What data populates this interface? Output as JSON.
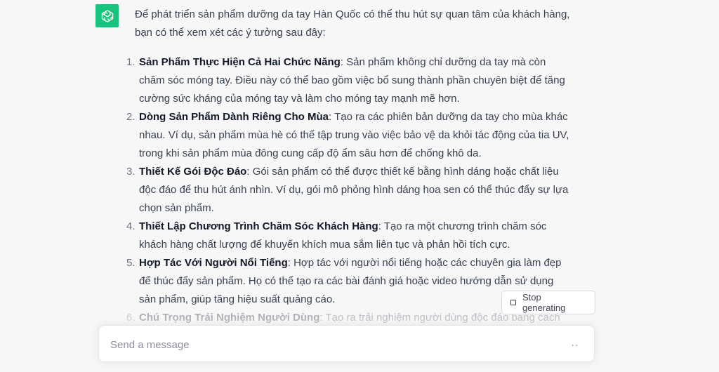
{
  "assistant_message": {
    "intro": "Để phát triển sản phẩm dưỡng da tay Hàn Quốc có thể thu hút sự quan tâm của khách hàng, bạn có thể xem xét các ý tưởng sau đây:",
    "items": [
      {
        "number": "1.",
        "title": "Sản Phẩm Thực Hiện Cả Hai Chức Năng",
        "text": ": Sản phẩm không chỉ dưỡng da tay mà còn chăm sóc móng tay. Điều này có thể bao gồm việc bổ sung thành phần chuyên biệt để tăng cường sức kháng của móng tay và làm cho móng tay mạnh mẽ hơn."
      },
      {
        "number": "2.",
        "title": "Dòng Sản Phẩm Dành Riêng Cho Mùa",
        "text": ": Tạo ra các phiên bản dưỡng da tay cho mùa khác nhau. Ví dụ, sản phẩm mùa hè có thể tập trung vào việc bảo vệ da khỏi tác động của tia UV, trong khi sản phẩm mùa đông cung cấp độ ẩm sâu hơn để chống khô da."
      },
      {
        "number": "3.",
        "title": "Thiết Kế Gói Độc Đáo",
        "text": ": Gói sản phẩm có thể được thiết kế bằng hình dáng hoặc chất liệu độc đáo để thu hút ánh nhìn. Ví dụ, gói mô phỏng hình dáng hoa sen có thể thúc đẩy sự lựa chọn sản phẩm."
      },
      {
        "number": "4.",
        "title": "Thiết Lập Chương Trình Chăm Sóc Khách Hàng",
        "text": ": Tạo ra một chương trình chăm sóc khách hàng chất lượng để khuyến khích mua sắm liên tục và phản hồi tích cực."
      },
      {
        "number": "5.",
        "title": "Hợp Tác Với Người Nổi Tiếng",
        "text": ": Hợp tác với người nổi tiếng hoặc các chuyên gia làm đẹp để thúc đẩy sản phẩm. Họ có thể tạo ra các bài đánh giá hoặc video hướng dẫn sử dụng sản phẩm, giúp tăng hiệu suất quảng cáo."
      },
      {
        "number": "6.",
        "title": "Chú Trọng Trải Nghiệm Người Dùng",
        "text": ": Tạo ra trải nghiệm người dùng độc đáo bằng cách"
      }
    ]
  },
  "stop_button": {
    "label": "Stop generating"
  },
  "composer": {
    "placeholder": "Send a message",
    "value": "",
    "status_dots": ".."
  },
  "colors": {
    "avatar_bg": "#19c37d",
    "page_bg": "#f7f7f8"
  },
  "icons": {
    "avatar": "openai-logo-icon",
    "stop": "stop-square-icon"
  }
}
